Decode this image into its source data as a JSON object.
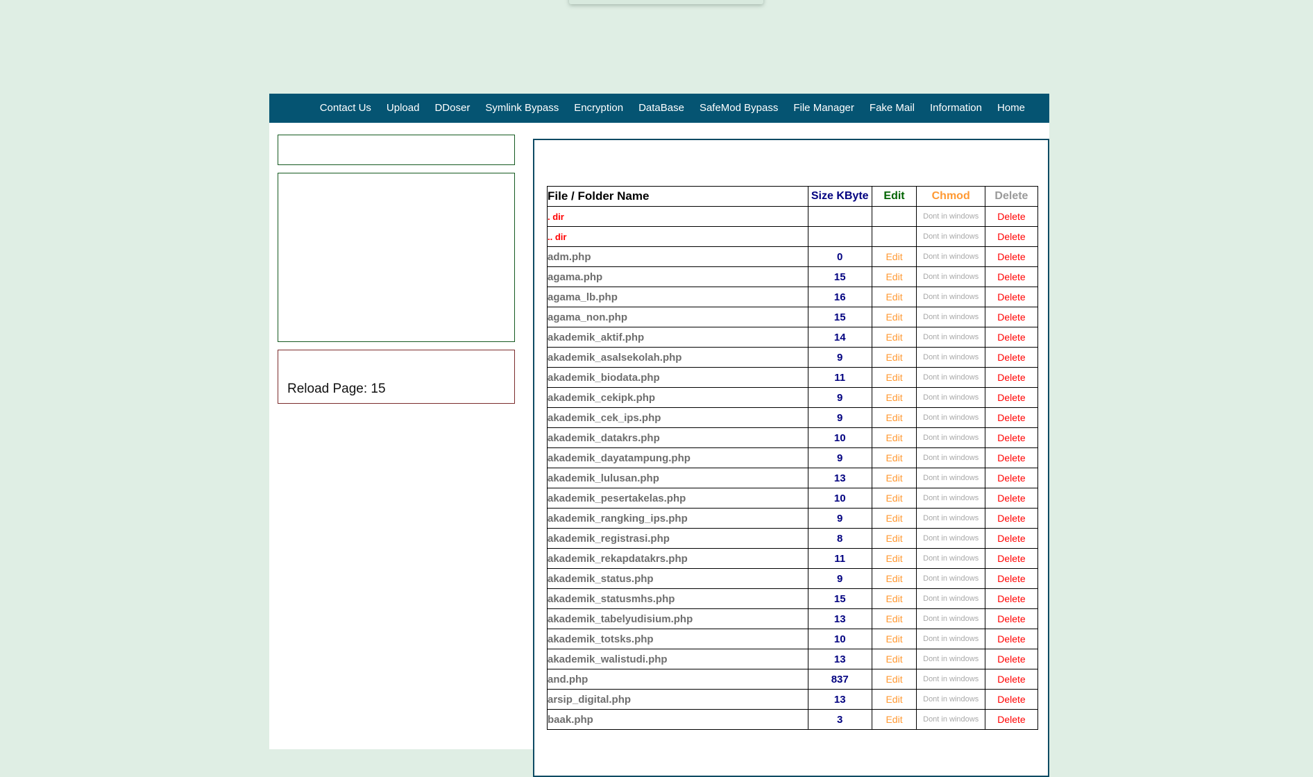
{
  "navbar": {
    "items": [
      {
        "label": "Contact Us",
        "name": "nav-contact-us"
      },
      {
        "label": "Upload",
        "name": "nav-upload"
      },
      {
        "label": "DDoser",
        "name": "nav-ddoser"
      },
      {
        "label": "Symlink Bypass",
        "name": "nav-symlink-bypass"
      },
      {
        "label": "Encryption",
        "name": "nav-encryption"
      },
      {
        "label": "DataBase",
        "name": "nav-database"
      },
      {
        "label": "SafeMod Bypass",
        "name": "nav-safemod-bypass"
      },
      {
        "label": "File Manager",
        "name": "nav-file-manager"
      },
      {
        "label": "Fake Mail",
        "name": "nav-fake-mail"
      },
      {
        "label": "Information",
        "name": "nav-information"
      },
      {
        "label": "Home",
        "name": "nav-home"
      }
    ],
    "background_color": "#055472"
  },
  "sidebar": {
    "reload_text": "Reload Page: 15",
    "box_border_green": "#14591f",
    "box_border_maroon": "#7b2b2b"
  },
  "file_table": {
    "headers": {
      "name": "File / Folder Name",
      "size": "Size KByte",
      "edit": "Edit",
      "chmod": "Chmod",
      "delete": "Delete"
    },
    "header_colors": {
      "name": "#000000",
      "size": "#000080",
      "edit": "#006400",
      "chmod": "#ff9933",
      "delete": "#9a9a9a"
    },
    "labels": {
      "edit": "Edit",
      "chmod": "Dont in windows",
      "delete": "Delete"
    },
    "rows": [
      {
        "name": ". dir",
        "size": "",
        "edit": "",
        "chmod": "Dont in windows",
        "delete": "Delete",
        "is_dir": true
      },
      {
        "name": ".. dir",
        "size": "",
        "edit": "",
        "chmod": "Dont in windows",
        "delete": "Delete",
        "is_dir": true
      },
      {
        "name": "adm.php",
        "size": "0",
        "edit": "Edit",
        "chmod": "Dont in windows",
        "delete": "Delete",
        "is_dir": false
      },
      {
        "name": "agama.php",
        "size": "15",
        "edit": "Edit",
        "chmod": "Dont in windows",
        "delete": "Delete",
        "is_dir": false
      },
      {
        "name": "agama_lb.php",
        "size": "16",
        "edit": "Edit",
        "chmod": "Dont in windows",
        "delete": "Delete",
        "is_dir": false
      },
      {
        "name": "agama_non.php",
        "size": "15",
        "edit": "Edit",
        "chmod": "Dont in windows",
        "delete": "Delete",
        "is_dir": false
      },
      {
        "name": "akademik_aktif.php",
        "size": "14",
        "edit": "Edit",
        "chmod": "Dont in windows",
        "delete": "Delete",
        "is_dir": false
      },
      {
        "name": "akademik_asalsekolah.php",
        "size": "9",
        "edit": "Edit",
        "chmod": "Dont in windows",
        "delete": "Delete",
        "is_dir": false
      },
      {
        "name": "akademik_biodata.php",
        "size": "11",
        "edit": "Edit",
        "chmod": "Dont in windows",
        "delete": "Delete",
        "is_dir": false
      },
      {
        "name": "akademik_cekipk.php",
        "size": "9",
        "edit": "Edit",
        "chmod": "Dont in windows",
        "delete": "Delete",
        "is_dir": false
      },
      {
        "name": "akademik_cek_ips.php",
        "size": "9",
        "edit": "Edit",
        "chmod": "Dont in windows",
        "delete": "Delete",
        "is_dir": false
      },
      {
        "name": "akademik_datakrs.php",
        "size": "10",
        "edit": "Edit",
        "chmod": "Dont in windows",
        "delete": "Delete",
        "is_dir": false
      },
      {
        "name": "akademik_dayatampung.php",
        "size": "9",
        "edit": "Edit",
        "chmod": "Dont in windows",
        "delete": "Delete",
        "is_dir": false
      },
      {
        "name": "akademik_lulusan.php",
        "size": "13",
        "edit": "Edit",
        "chmod": "Dont in windows",
        "delete": "Delete",
        "is_dir": false
      },
      {
        "name": "akademik_pesertakelas.php",
        "size": "10",
        "edit": "Edit",
        "chmod": "Dont in windows",
        "delete": "Delete",
        "is_dir": false
      },
      {
        "name": "akademik_rangking_ips.php",
        "size": "9",
        "edit": "Edit",
        "chmod": "Dont in windows",
        "delete": "Delete",
        "is_dir": false
      },
      {
        "name": "akademik_registrasi.php",
        "size": "8",
        "edit": "Edit",
        "chmod": "Dont in windows",
        "delete": "Delete",
        "is_dir": false
      },
      {
        "name": "akademik_rekapdatakrs.php",
        "size": "11",
        "edit": "Edit",
        "chmod": "Dont in windows",
        "delete": "Delete",
        "is_dir": false
      },
      {
        "name": "akademik_status.php",
        "size": "9",
        "edit": "Edit",
        "chmod": "Dont in windows",
        "delete": "Delete",
        "is_dir": false
      },
      {
        "name": "akademik_statusmhs.php",
        "size": "15",
        "edit": "Edit",
        "chmod": "Dont in windows",
        "delete": "Delete",
        "is_dir": false
      },
      {
        "name": "akademik_tabelyudisium.php",
        "size": "13",
        "edit": "Edit",
        "chmod": "Dont in windows",
        "delete": "Delete",
        "is_dir": false
      },
      {
        "name": "akademik_totsks.php",
        "size": "10",
        "edit": "Edit",
        "chmod": "Dont in windows",
        "delete": "Delete",
        "is_dir": false
      },
      {
        "name": "akademik_walistudi.php",
        "size": "13",
        "edit": "Edit",
        "chmod": "Dont in windows",
        "delete": "Delete",
        "is_dir": false
      },
      {
        "name": "and.php",
        "size": "837",
        "edit": "Edit",
        "chmod": "Dont in windows",
        "delete": "Delete",
        "is_dir": false
      },
      {
        "name": "arsip_digital.php",
        "size": "13",
        "edit": "Edit",
        "chmod": "Dont in windows",
        "delete": "Delete",
        "is_dir": false
      },
      {
        "name": "baak.php",
        "size": "3",
        "edit": "Edit",
        "chmod": "Dont in windows",
        "delete": "Delete",
        "is_dir": false
      }
    ]
  }
}
